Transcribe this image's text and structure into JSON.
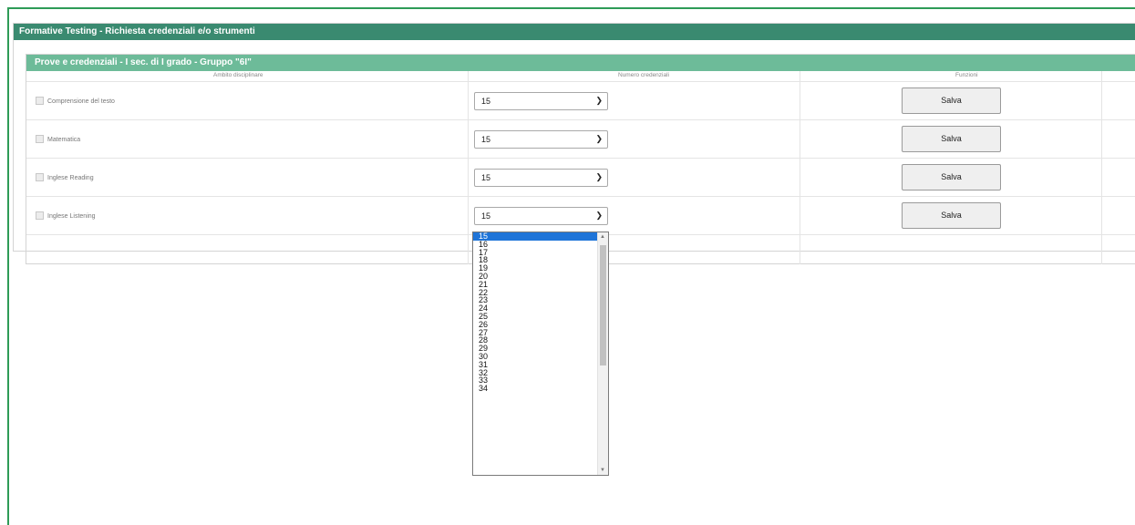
{
  "main_title": "Formative Testing - Richiesta credenziali e/o strumenti",
  "subtitle": "Prove e credenziali - I sec. di I grado - Gruppo \"6I\"",
  "columns": [
    "Ambito disciplinare",
    "Numero credenziali",
    "Funzioni"
  ],
  "rows": [
    {
      "subject": "Comprensione del testo",
      "value": "15",
      "button": "Salva"
    },
    {
      "subject": "Matematica",
      "value": "15",
      "button": "Salva"
    },
    {
      "subject": "Inglese Reading",
      "value": "15",
      "button": "Salva"
    },
    {
      "subject": "Inglese Listening",
      "value": "15",
      "button": "Salva"
    }
  ],
  "dropdown": {
    "selected": "15",
    "options": [
      "15",
      "16",
      "17",
      "18",
      "19",
      "20",
      "21",
      "22",
      "23",
      "24",
      "25",
      "26",
      "27",
      "28",
      "29",
      "30",
      "31",
      "32",
      "33",
      "34"
    ]
  },
  "icons": {
    "chevron": "chevron-down-icon",
    "scroll_up": "scroll-up-icon",
    "scroll_down": "scroll-down-icon"
  }
}
